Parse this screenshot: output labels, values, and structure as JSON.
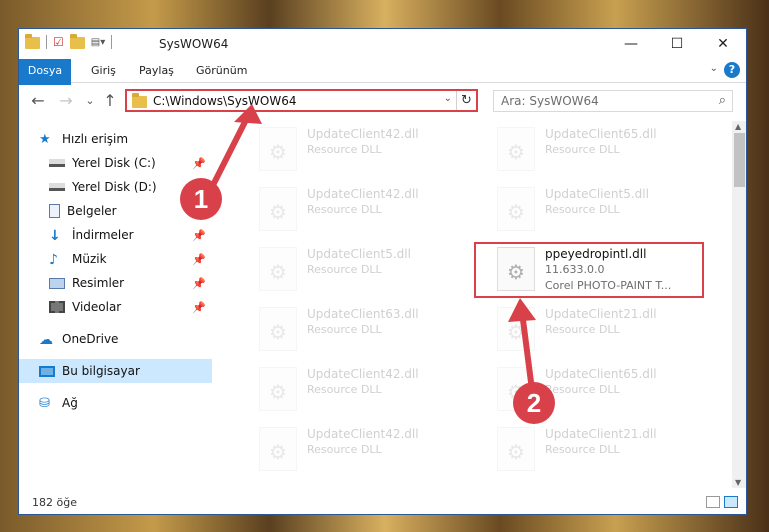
{
  "window": {
    "title": "SysWOW64",
    "controls": {
      "minimize": "—",
      "maximize": "☐",
      "close": "✕"
    }
  },
  "ribbon": {
    "tabs": [
      "Dosya",
      "Giriş",
      "Paylaş",
      "Görünüm"
    ],
    "help": "?"
  },
  "nav": {
    "back": "←",
    "forward": "→",
    "recent": "⌄",
    "up": "↑",
    "address": "C:\\Windows\\SysWOW64",
    "address_dropdown": "⌄",
    "refresh": "↻",
    "search_placeholder": "Ara: SysWOW64",
    "search_icon": "⌕"
  },
  "sidebar": {
    "items": [
      {
        "label": "Hızlı erişim",
        "icon": "star-icon",
        "pinned": false
      },
      {
        "label": "Yerel Disk (C:)",
        "icon": "drive-icon",
        "pinned": true
      },
      {
        "label": "Yerel Disk (D:)",
        "icon": "drive-icon",
        "pinned": false
      },
      {
        "label": "Belgeler",
        "icon": "documents-icon",
        "pinned": true
      },
      {
        "label": "İndirmeler",
        "icon": "download-icon",
        "pinned": true
      },
      {
        "label": "Müzik",
        "icon": "music-icon",
        "pinned": true
      },
      {
        "label": "Resimler",
        "icon": "pictures-icon",
        "pinned": true
      },
      {
        "label": "Videolar",
        "icon": "videos-icon",
        "pinned": true
      },
      {
        "label": "OneDrive",
        "icon": "cloud-icon",
        "pinned": false
      },
      {
        "label": "Bu bilgisayar",
        "icon": "computer-icon",
        "pinned": false,
        "selected": true
      },
      {
        "label": "Ağ",
        "icon": "network-icon",
        "pinned": false
      }
    ],
    "pin_glyph": "📌"
  },
  "files": [
    {
      "name": "UpdateClient42.dll",
      "type": "Resource DLL"
    },
    {
      "name": "UpdateClient65.dll",
      "type": "Resource DLL"
    },
    {
      "name": "UpdateClient42.dll",
      "type": "Resource DLL"
    },
    {
      "name": "UpdateClient5.dll",
      "type": "Resource DLL"
    },
    {
      "name": "UpdateClient5.dll",
      "type": "Resource DLL"
    },
    {
      "name": "ppeyedropintl.dll",
      "version": "11.633.0.0",
      "description": "Corel PHOTO-PAINT T...",
      "highlighted": true
    },
    {
      "name": "UpdateClient63.dll",
      "type": "Resource DLL"
    },
    {
      "name": "UpdateClient21.dll",
      "type": "Resource DLL"
    },
    {
      "name": "UpdateClient42.dll",
      "type": "Resource DLL"
    },
    {
      "name": "UpdateClient65.dll",
      "type": "Resource DLL"
    },
    {
      "name": "UpdateClient42.dll",
      "type": "Resource DLL"
    },
    {
      "name": "UpdateClient21.dll",
      "type": "Resource DLL"
    }
  ],
  "status": {
    "count": "182 öğe"
  },
  "annotations": {
    "step1": "1",
    "step2": "2",
    "color": "#d9414a"
  }
}
